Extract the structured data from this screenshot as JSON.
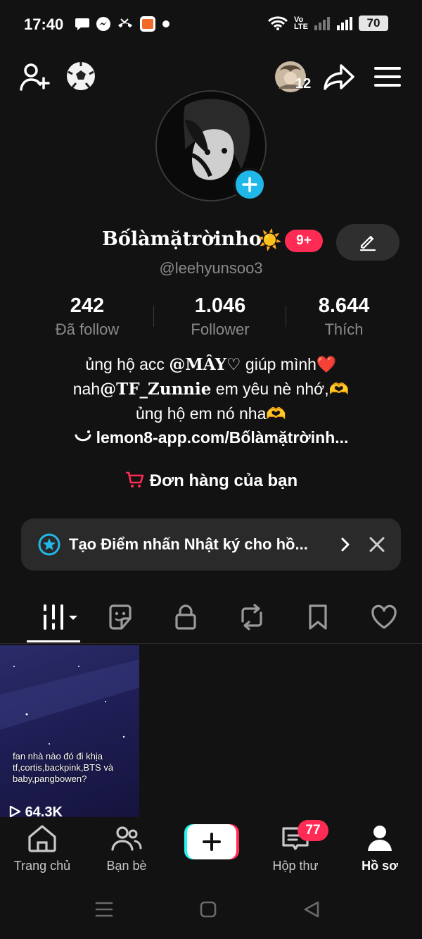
{
  "status_bar": {
    "time": "17:40",
    "network_label": "Vo\nLTE",
    "battery": "70"
  },
  "top_bar": {
    "notification_count": "12"
  },
  "profile": {
    "display_name": "Bốlàmặtrờinho",
    "name_emoji": "☀️",
    "badge": "9+",
    "username": "@leehyunsoo3"
  },
  "stats": [
    {
      "value": "242",
      "label": "Đã follow"
    },
    {
      "value": "1.046",
      "label": "Follower"
    },
    {
      "value": "8.644",
      "label": "Thích"
    }
  ],
  "bio": {
    "line1_pre": "ủng hộ acc ",
    "line1_mention": "@MÂY♡",
    "line1_post": " giúp mình❤️",
    "line2_pre": "nah",
    "line2_mention": "@TF_Zunnie",
    "line2_post": " em yêu nè nhớ,🫶",
    "line3": "ủng hộ em nó nha🫶",
    "link": "lemon8-app.com/Bốlàmặtrờinh..."
  },
  "orders_label": "Đơn hàng của bạn",
  "banner": {
    "text": "Tạo Điểm nhấn Nhật ký cho hồ..."
  },
  "video": {
    "caption": "fan nhà nào đó đi khịa tf,cortis,backpink,BTS và baby,pangbowen?",
    "views": "64.3K"
  },
  "bottom_nav": {
    "home": "Trang chủ",
    "friends": "Bạn bè",
    "inbox": "Hộp thư",
    "inbox_badge": "77",
    "profile": "Hồ sơ"
  },
  "colors": {
    "background": "#121212",
    "accent_red": "#fe2c55",
    "accent_cyan": "#20b8e8",
    "muted_text": "#8a8a8a"
  }
}
